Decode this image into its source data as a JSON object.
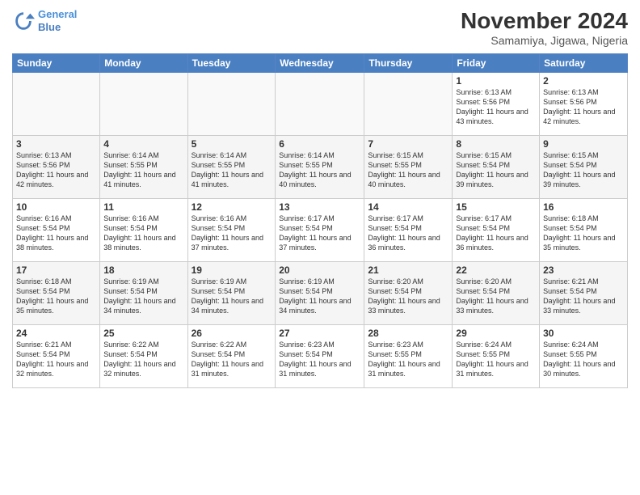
{
  "logo": {
    "line1": "General",
    "line2": "Blue"
  },
  "title": "November 2024",
  "location": "Samamiya, Jigawa, Nigeria",
  "days_of_week": [
    "Sunday",
    "Monday",
    "Tuesday",
    "Wednesday",
    "Thursday",
    "Friday",
    "Saturday"
  ],
  "weeks": [
    [
      {
        "day": "",
        "info": ""
      },
      {
        "day": "",
        "info": ""
      },
      {
        "day": "",
        "info": ""
      },
      {
        "day": "",
        "info": ""
      },
      {
        "day": "",
        "info": ""
      },
      {
        "day": "1",
        "info": "Sunrise: 6:13 AM\nSunset: 5:56 PM\nDaylight: 11 hours\nand 43 minutes."
      },
      {
        "day": "2",
        "info": "Sunrise: 6:13 AM\nSunset: 5:56 PM\nDaylight: 11 hours\nand 42 minutes."
      }
    ],
    [
      {
        "day": "3",
        "info": "Sunrise: 6:13 AM\nSunset: 5:56 PM\nDaylight: 11 hours\nand 42 minutes."
      },
      {
        "day": "4",
        "info": "Sunrise: 6:14 AM\nSunset: 5:55 PM\nDaylight: 11 hours\nand 41 minutes."
      },
      {
        "day": "5",
        "info": "Sunrise: 6:14 AM\nSunset: 5:55 PM\nDaylight: 11 hours\nand 41 minutes."
      },
      {
        "day": "6",
        "info": "Sunrise: 6:14 AM\nSunset: 5:55 PM\nDaylight: 11 hours\nand 40 minutes."
      },
      {
        "day": "7",
        "info": "Sunrise: 6:15 AM\nSunset: 5:55 PM\nDaylight: 11 hours\nand 40 minutes."
      },
      {
        "day": "8",
        "info": "Sunrise: 6:15 AM\nSunset: 5:54 PM\nDaylight: 11 hours\nand 39 minutes."
      },
      {
        "day": "9",
        "info": "Sunrise: 6:15 AM\nSunset: 5:54 PM\nDaylight: 11 hours\nand 39 minutes."
      }
    ],
    [
      {
        "day": "10",
        "info": "Sunrise: 6:16 AM\nSunset: 5:54 PM\nDaylight: 11 hours\nand 38 minutes."
      },
      {
        "day": "11",
        "info": "Sunrise: 6:16 AM\nSunset: 5:54 PM\nDaylight: 11 hours\nand 38 minutes."
      },
      {
        "day": "12",
        "info": "Sunrise: 6:16 AM\nSunset: 5:54 PM\nDaylight: 11 hours\nand 37 minutes."
      },
      {
        "day": "13",
        "info": "Sunrise: 6:17 AM\nSunset: 5:54 PM\nDaylight: 11 hours\nand 37 minutes."
      },
      {
        "day": "14",
        "info": "Sunrise: 6:17 AM\nSunset: 5:54 PM\nDaylight: 11 hours\nand 36 minutes."
      },
      {
        "day": "15",
        "info": "Sunrise: 6:17 AM\nSunset: 5:54 PM\nDaylight: 11 hours\nand 36 minutes."
      },
      {
        "day": "16",
        "info": "Sunrise: 6:18 AM\nSunset: 5:54 PM\nDaylight: 11 hours\nand 35 minutes."
      }
    ],
    [
      {
        "day": "17",
        "info": "Sunrise: 6:18 AM\nSunset: 5:54 PM\nDaylight: 11 hours\nand 35 minutes."
      },
      {
        "day": "18",
        "info": "Sunrise: 6:19 AM\nSunset: 5:54 PM\nDaylight: 11 hours\nand 34 minutes."
      },
      {
        "day": "19",
        "info": "Sunrise: 6:19 AM\nSunset: 5:54 PM\nDaylight: 11 hours\nand 34 minutes."
      },
      {
        "day": "20",
        "info": "Sunrise: 6:19 AM\nSunset: 5:54 PM\nDaylight: 11 hours\nand 34 minutes."
      },
      {
        "day": "21",
        "info": "Sunrise: 6:20 AM\nSunset: 5:54 PM\nDaylight: 11 hours\nand 33 minutes."
      },
      {
        "day": "22",
        "info": "Sunrise: 6:20 AM\nSunset: 5:54 PM\nDaylight: 11 hours\nand 33 minutes."
      },
      {
        "day": "23",
        "info": "Sunrise: 6:21 AM\nSunset: 5:54 PM\nDaylight: 11 hours\nand 33 minutes."
      }
    ],
    [
      {
        "day": "24",
        "info": "Sunrise: 6:21 AM\nSunset: 5:54 PM\nDaylight: 11 hours\nand 32 minutes."
      },
      {
        "day": "25",
        "info": "Sunrise: 6:22 AM\nSunset: 5:54 PM\nDaylight: 11 hours\nand 32 minutes."
      },
      {
        "day": "26",
        "info": "Sunrise: 6:22 AM\nSunset: 5:54 PM\nDaylight: 11 hours\nand 31 minutes."
      },
      {
        "day": "27",
        "info": "Sunrise: 6:23 AM\nSunset: 5:54 PM\nDaylight: 11 hours\nand 31 minutes."
      },
      {
        "day": "28",
        "info": "Sunrise: 6:23 AM\nSunset: 5:55 PM\nDaylight: 11 hours\nand 31 minutes."
      },
      {
        "day": "29",
        "info": "Sunrise: 6:24 AM\nSunset: 5:55 PM\nDaylight: 11 hours\nand 31 minutes."
      },
      {
        "day": "30",
        "info": "Sunrise: 6:24 AM\nSunset: 5:55 PM\nDaylight: 11 hours\nand 30 minutes."
      }
    ]
  ]
}
